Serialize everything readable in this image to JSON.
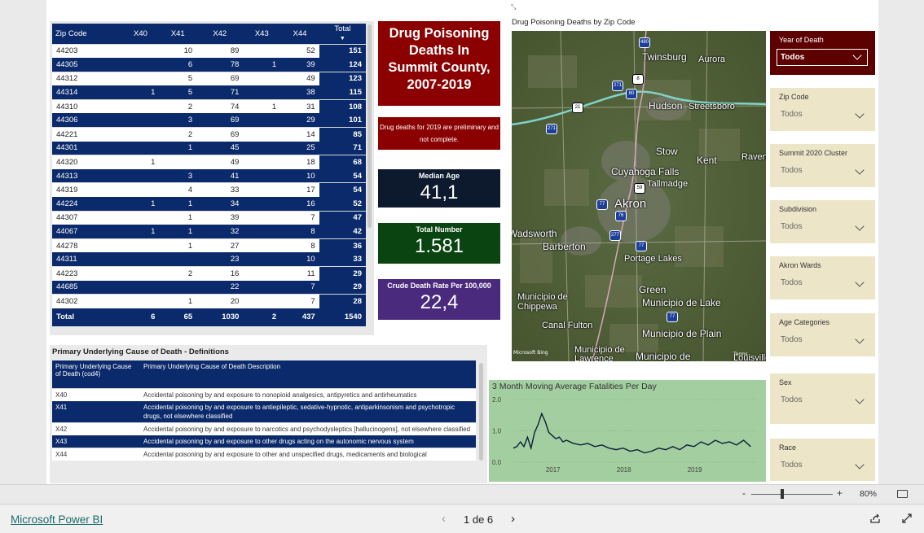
{
  "zip_table": {
    "headers": [
      "Zip Code",
      "X40",
      "X41",
      "X42",
      "X43",
      "X44",
      "Total"
    ],
    "rows": [
      {
        "zip": "44203",
        "x40": "",
        "x41": "10",
        "x42": "89",
        "x43": "",
        "x44": "52",
        "total": "151",
        "style": "w"
      },
      {
        "zip": "44305",
        "x40": "",
        "x41": "6",
        "x42": "78",
        "x43": "1",
        "x44": "39",
        "total": "124",
        "style": "b"
      },
      {
        "zip": "44312",
        "x40": "",
        "x41": "5",
        "x42": "69",
        "x43": "",
        "x44": "49",
        "total": "123",
        "style": "w"
      },
      {
        "zip": "44314",
        "x40": "1",
        "x41": "5",
        "x42": "71",
        "x43": "",
        "x44": "38",
        "total": "115",
        "style": "b"
      },
      {
        "zip": "44310",
        "x40": "",
        "x41": "2",
        "x42": "74",
        "x43": "1",
        "x44": "31",
        "total": "108",
        "style": "w"
      },
      {
        "zip": "44306",
        "x40": "",
        "x41": "3",
        "x42": "69",
        "x43": "",
        "x44": "29",
        "total": "101",
        "style": "b"
      },
      {
        "zip": "44221",
        "x40": "",
        "x41": "2",
        "x42": "69",
        "x43": "",
        "x44": "14",
        "total": "85",
        "style": "w"
      },
      {
        "zip": "44301",
        "x40": "",
        "x41": "1",
        "x42": "45",
        "x43": "",
        "x44": "25",
        "total": "71",
        "style": "b"
      },
      {
        "zip": "44320",
        "x40": "1",
        "x41": "",
        "x42": "49",
        "x43": "",
        "x44": "18",
        "total": "68",
        "style": "w"
      },
      {
        "zip": "44313",
        "x40": "",
        "x41": "3",
        "x42": "41",
        "x43": "",
        "x44": "10",
        "total": "54",
        "style": "b"
      },
      {
        "zip": "44319",
        "x40": "",
        "x41": "4",
        "x42": "33",
        "x43": "",
        "x44": "17",
        "total": "54",
        "style": "w"
      },
      {
        "zip": "44224",
        "x40": "1",
        "x41": "1",
        "x42": "34",
        "x43": "",
        "x44": "16",
        "total": "52",
        "style": "b"
      },
      {
        "zip": "44307",
        "x40": "",
        "x41": "1",
        "x42": "39",
        "x43": "",
        "x44": "7",
        "total": "47",
        "style": "w"
      },
      {
        "zip": "44067",
        "x40": "1",
        "x41": "1",
        "x42": "32",
        "x43": "",
        "x44": "8",
        "total": "42",
        "style": "b"
      },
      {
        "zip": "44278",
        "x40": "",
        "x41": "1",
        "x42": "27",
        "x43": "",
        "x44": "8",
        "total": "36",
        "style": "w"
      },
      {
        "zip": "44311",
        "x40": "",
        "x41": "",
        "x42": "23",
        "x43": "",
        "x44": "10",
        "total": "33",
        "style": "b"
      },
      {
        "zip": "44223",
        "x40": "",
        "x41": "2",
        "x42": "16",
        "x43": "",
        "x44": "11",
        "total": "29",
        "style": "w"
      },
      {
        "zip": "44685",
        "x40": "",
        "x41": "",
        "x42": "22",
        "x43": "",
        "x44": "7",
        "total": "29",
        "style": "b"
      },
      {
        "zip": "44302",
        "x40": "",
        "x41": "1",
        "x42": "20",
        "x43": "",
        "x44": "7",
        "total": "28",
        "style": "w"
      }
    ],
    "total_row": {
      "label": "Total",
      "x40": "6",
      "x41": "65",
      "x42": "1030",
      "x43": "2",
      "x44": "437",
      "total": "1540"
    }
  },
  "title_box": {
    "line1": "Drug Poisoning",
    "line2": "Deaths In",
    "line3": "Summit County,",
    "line4": "2007-2019"
  },
  "note": {
    "line1": "Drug deaths for 2019 are preliminary and",
    "line2": "not complete."
  },
  "cards": {
    "median_age": {
      "label": "Median Age",
      "value": "41,1",
      "color": "#0d1a2e"
    },
    "total_number": {
      "label": "Total Number",
      "value": "1.581",
      "color": "#0a4410"
    },
    "crude_rate": {
      "label": "Crude Death Rate Per 100,000",
      "value": "22,4",
      "color": "#4a2a7c"
    }
  },
  "map": {
    "title": "Drug Poisoning Deaths by Zip Code",
    "labels": [
      "Twinsburg",
      "Aurora",
      "Hudson",
      "Streetsboro",
      "Stow",
      "Kent",
      "Ravenna",
      "Cuyahoga Falls",
      "Tallmadge",
      "Akron",
      "Wadsworth",
      "Barberton",
      "Portage Lakes",
      "Green",
      "Municipio de Lake",
      "Municipio de Chippewa",
      "Canal Fulton",
      "Municipio de Plain",
      "Municipio de Lawrence",
      "Municipio de",
      "Louisville"
    ],
    "shields": [
      "480",
      "8",
      "271",
      "80",
      "21",
      "271",
      "59",
      "77",
      "76",
      "277",
      "77",
      "77"
    ],
    "attribution": "Microsoft Bing",
    "terms": "Terms"
  },
  "slicers": {
    "year": {
      "title": "Year of Death",
      "value": "Todos"
    },
    "zip": {
      "title": "Zip Code",
      "value": "Todos"
    },
    "cluster": {
      "title": "Summit 2020 Cluster",
      "value": "Todos"
    },
    "subdivision": {
      "title": "Subdivision",
      "value": "Todos"
    },
    "wards": {
      "title": "Akron Wards",
      "value": "Todos"
    },
    "age": {
      "title": "Age Categories",
      "value": "Todos"
    },
    "sex": {
      "title": "Sex",
      "value": "Todos"
    },
    "race": {
      "title": "Race",
      "value": "Todos"
    }
  },
  "definitions": {
    "title": "Primary Underlying Cause of Death - Definitions",
    "header_code": "Primary Underlying Cause of Death (cod4)",
    "header_desc": "Primary Underlying Cause of Death Description",
    "rows": [
      {
        "code": "X40",
        "desc": "Accidental poisoning by and exposure to nonopioid analgesics, antipyretics and antirheumatics",
        "style": "w"
      },
      {
        "code": "X41",
        "desc": "Accidental poisoning by and exposure to antiepileptic, sedative-hypnotic, antiparkinsonism and psychotropic drugs, not elsewhere classified",
        "style": "b"
      },
      {
        "code": "X42",
        "desc": "Accidental poisoning by and exposure to narcotics and psychodysleptics [hallucinogens], not elsewhere classified",
        "style": "w"
      },
      {
        "code": "X43",
        "desc": "Accidental poisoning by and exposure to other drugs acting on the autonomic nervous system",
        "style": "b"
      },
      {
        "code": "X44",
        "desc": "Accidental poisoning by and exposure to other and unspecified drugs, medicaments and biological",
        "style": "w"
      }
    ]
  },
  "chart_data": {
    "type": "line",
    "title": "3 Month Moving Average Fatalities Per Day",
    "xlabel": "",
    "ylabel": "",
    "ylim": [
      0.0,
      2.0
    ],
    "yticks": [
      "2.0",
      "1.0",
      "0.0"
    ],
    "xticks": [
      "2017",
      "2018",
      "2019"
    ],
    "xlim": [
      2016.45,
      2019.9
    ],
    "x": [
      2016.45,
      2016.5,
      2016.55,
      2016.6,
      2016.65,
      2016.7,
      2016.75,
      2016.8,
      2016.85,
      2016.9,
      2016.95,
      2017.0,
      2017.05,
      2017.1,
      2017.15,
      2017.2,
      2017.3,
      2017.4,
      2017.5,
      2017.6,
      2017.7,
      2017.8,
      2017.9,
      2018.0,
      2018.1,
      2018.2,
      2018.3,
      2018.4,
      2018.5,
      2018.6,
      2018.7,
      2018.8,
      2018.9,
      2019.0,
      2019.1,
      2019.2,
      2019.3,
      2019.4,
      2019.5,
      2019.6,
      2019.7,
      2019.8
    ],
    "values": [
      0.45,
      0.5,
      0.65,
      0.5,
      0.8,
      0.45,
      0.95,
      1.2,
      1.55,
      1.3,
      0.95,
      0.85,
      0.75,
      0.8,
      0.65,
      0.7,
      0.6,
      0.55,
      0.6,
      0.5,
      0.55,
      0.45,
      0.4,
      0.45,
      0.35,
      0.4,
      0.3,
      0.35,
      0.45,
      0.4,
      0.5,
      0.4,
      0.55,
      0.5,
      0.65,
      0.55,
      0.7,
      0.6,
      0.65,
      0.55,
      0.7,
      0.5
    ]
  },
  "zoom": {
    "minus": "-",
    "plus": "+",
    "level": "80%"
  },
  "footer": {
    "brand": "Microsoft Power BI",
    "page": "1 de 6"
  }
}
